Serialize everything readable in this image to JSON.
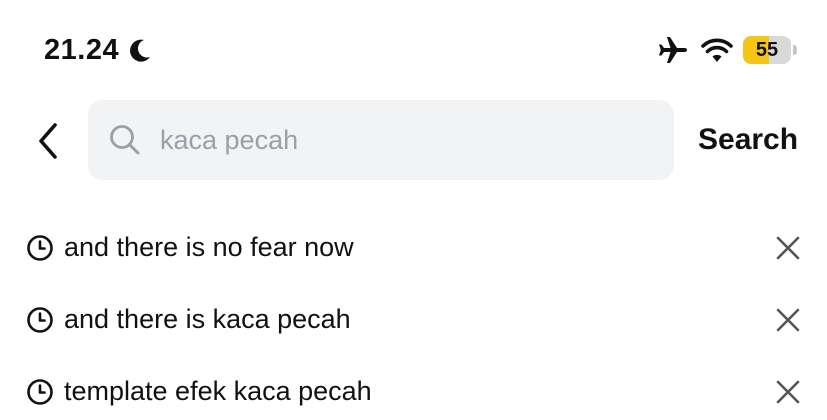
{
  "status_bar": {
    "time": "21.24",
    "battery_level": 55,
    "battery_label": "55",
    "icons": [
      "moon-icon",
      "airplane-icon",
      "wifi-icon",
      "battery-icon"
    ],
    "battery_color": "#f5c518"
  },
  "header": {
    "back_icon": "chevron-left-icon",
    "search": {
      "value": "",
      "placeholder": "kaca pecah",
      "icon": "search-icon"
    },
    "submit_label": "Search"
  },
  "history": {
    "items": [
      {
        "label": "and there is no fear now"
      },
      {
        "label": "and there is kaca pecah"
      },
      {
        "label": "template efek kaca pecah"
      }
    ],
    "item_icon": "clock-icon",
    "remove_icon": "close-icon"
  },
  "colors": {
    "search_bg": "#f2f3f5",
    "placeholder": "#9aa0a8",
    "text": "#111111"
  }
}
